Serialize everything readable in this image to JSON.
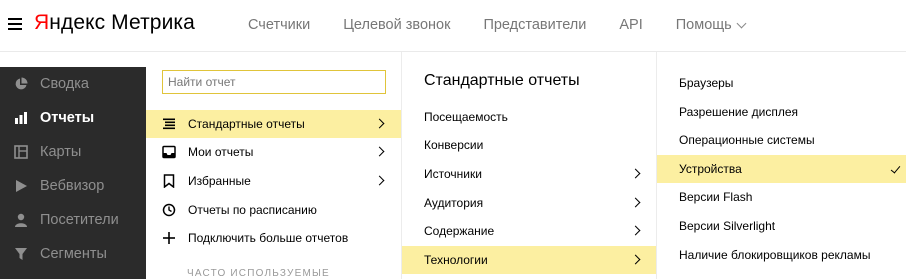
{
  "header": {
    "logo_brand_first": "Я",
    "logo_brand_rest": "ндекс",
    "logo_product": "Метрика",
    "nav": [
      {
        "label": "Счетчики"
      },
      {
        "label": "Целевой звонок"
      },
      {
        "label": "Представители"
      },
      {
        "label": "API"
      },
      {
        "label": "Помощь"
      }
    ]
  },
  "sidebar": {
    "items": [
      {
        "label": "Сводка",
        "icon": "pie-chart-icon"
      },
      {
        "label": "Отчеты",
        "icon": "bar-chart-icon",
        "active": true
      },
      {
        "label": "Карты",
        "icon": "map-icon"
      },
      {
        "label": "Вебвизор",
        "icon": "play-icon"
      },
      {
        "label": "Посетители",
        "icon": "user-icon"
      },
      {
        "label": "Сегменты",
        "icon": "filter-icon"
      }
    ]
  },
  "reports": {
    "search_placeholder": "Найти отчет",
    "items": [
      {
        "label": "Стандартные отчеты",
        "icon": "list-icon",
        "has_arrow": true,
        "selected": true
      },
      {
        "label": "Мои отчеты",
        "icon": "inbox-icon",
        "has_arrow": true
      },
      {
        "label": "Избранные",
        "icon": "bookmark-icon",
        "has_arrow": true
      },
      {
        "label": "Отчеты по расписанию",
        "icon": "clock-icon",
        "has_arrow": false
      },
      {
        "label": "Подключить больше отчетов",
        "icon": "plus-icon",
        "has_arrow": false
      }
    ],
    "frequent_label": "ЧАСТО ИСПОЛЬЗУЕМЫЕ"
  },
  "standard": {
    "title": "Стандартные отчеты",
    "items": [
      {
        "label": "Посещаемость",
        "has_arrow": false
      },
      {
        "label": "Конверсии",
        "has_arrow": false
      },
      {
        "label": "Источники",
        "has_arrow": true
      },
      {
        "label": "Аудитория",
        "has_arrow": true
      },
      {
        "label": "Содержание",
        "has_arrow": true
      },
      {
        "label": "Технологии",
        "has_arrow": true,
        "selected": true
      }
    ]
  },
  "technologies": {
    "items": [
      {
        "label": "Браузеры"
      },
      {
        "label": "Разрешение дисплея"
      },
      {
        "label": "Операционные системы"
      },
      {
        "label": "Устройства",
        "selected": true
      },
      {
        "label": "Версии Flash"
      },
      {
        "label": "Версии Silverlight"
      },
      {
        "label": "Наличие блокировщиков рекламы"
      }
    ]
  },
  "colors": {
    "brand_red": "#ff0000",
    "sidebar_bg": "#2b2b2b",
    "highlight_yellow": "#fcefa1",
    "search_border": "#e0c43a"
  }
}
